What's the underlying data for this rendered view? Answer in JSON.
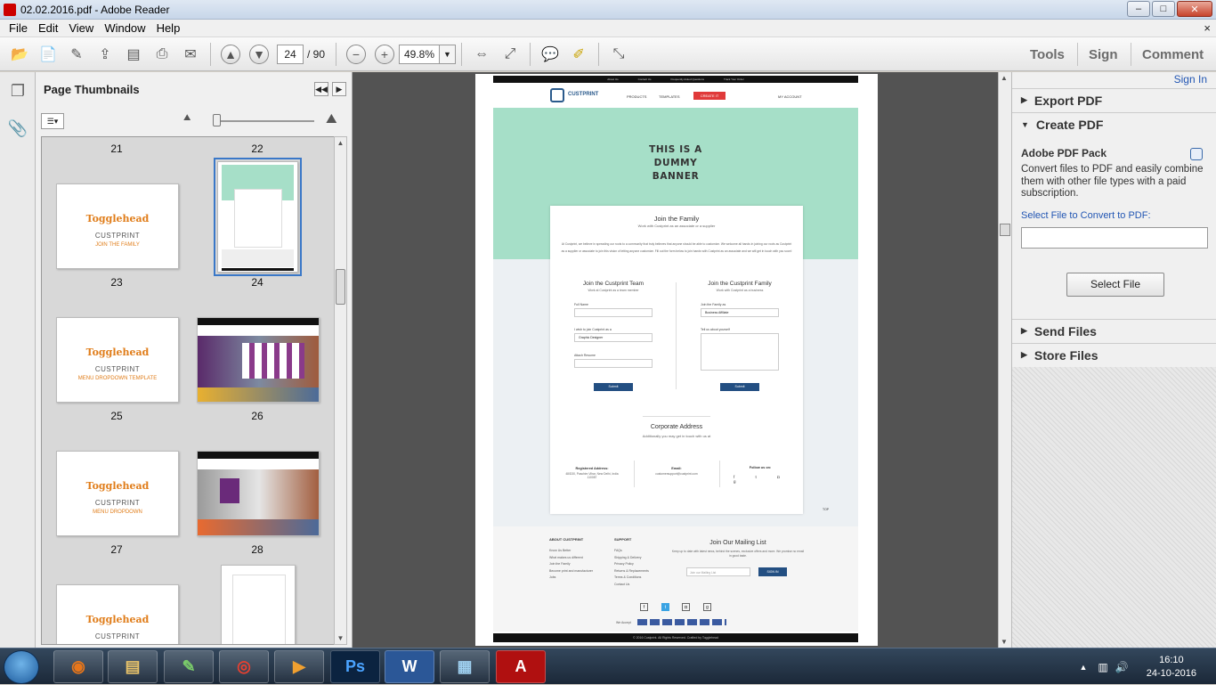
{
  "window": {
    "title": "02.02.2016.pdf - Adobe Reader",
    "minimize": "–",
    "maximize": "□",
    "close": "✕"
  },
  "menu": {
    "items": [
      "File",
      "Edit",
      "View",
      "Window",
      "Help"
    ],
    "close_glyph": "×"
  },
  "toolbar": {
    "page_current": "24",
    "page_total": "/ 90",
    "zoom": "49.8%",
    "right_tools": [
      "Tools",
      "Sign",
      "Comment"
    ]
  },
  "thumbnails": {
    "title": "Page Thumbnails",
    "page_labels": [
      "21",
      "22",
      "23",
      "24",
      "25",
      "26",
      "27",
      "28"
    ],
    "brand": "Togglehead",
    "thumb_title": "CUSTPRINT",
    "thumb_subtitles": [
      "JOIN THE FAMILY",
      "MENU DROPDOWN TEMPLATE",
      "MENU DROPDOWN"
    ],
    "selected_page": "24"
  },
  "doc": {
    "topbar_links": [
      "About Us",
      "Contact Us",
      "Frequently Asked Questions",
      "Track Your Order"
    ],
    "logo": "CUSTPRINT",
    "nav": [
      "PRODUCTS",
      "TEMPLATES",
      "CREATE IT",
      "MY ACCOUNT"
    ],
    "banner": "THIS IS A DUMMY BANNER",
    "join_title": "Join the Family",
    "join_sub": "Work with Custprint as an associate or a supplier",
    "join_body": "At Custprint, we believe in spreading our roots to a community that truly believes that anyone should be able to customize. We welcome all hands in joining our roots as Custprint as a supplier or associate to join this vision of letting anyone customize. Fill out the form below to join hands with Custprint as an associate and we will get in touch with you soon!",
    "team_title": "Join the Custprint Team",
    "team_sub": "Work at Custprint as a team member",
    "family_title": "Join the Custprint Family",
    "family_sub": "Work with Custprint as a business",
    "full_name": "Full Name",
    "wish_label": "I wish to join Custprint as a",
    "wish_value": "Graphic Designer",
    "attach": "Attach Resume",
    "join_as_label": "Join the Family as",
    "join_as_value": "Business Affiliate",
    "tell_label": "Tell us about yourself",
    "submit": "Submit",
    "corp_title": "Corporate Address",
    "corp_sub": "Additionally you may get in touch with us at",
    "reg_label": "Registered Address:",
    "reg_value": "48/D30, Paschim Vihar, New Delhi, India 110087",
    "email_label": "Email:",
    "email_value": "customersupport@custprint.com",
    "follow": "Follow us on:",
    "top": "TOP",
    "footer_about_h": "ABOUT CUSTPRINT",
    "footer_about": [
      "Know Us Better",
      "What makes us different",
      "Join the Family",
      "Become print and manufacturer",
      "Jobs"
    ],
    "footer_support_h": "SUPPORT",
    "footer_support": [
      "FAQs",
      "Shipping & Delivery",
      "Privacy Policy",
      "Returns & Replacements",
      "Terms & Conditions",
      "Contact Us"
    ],
    "mailing_title": "Join Our Mailing List",
    "mailing_sub": "Keep up to date with latest news, behind the scenes, exclusive offers and more. We promise no email in good taste.",
    "mailing_placeholder": "Join our Mailing List",
    "mailing_btn": "SIGN IN",
    "accept": "We Accept",
    "copyright": "© 2016 Custprint. All Rights Reserved. Crafted by Togglehead"
  },
  "rightpanel": {
    "signin": "Sign In",
    "export": "Export PDF",
    "create": "Create PDF",
    "pack_title": "Adobe PDF Pack",
    "pack_desc": "Convert files to PDF and easily combine them with other file types with a paid subscription.",
    "select_label": "Select File to Convert to PDF:",
    "select_btn": "Select File",
    "send": "Send Files",
    "store": "Store Files"
  },
  "taskbar": {
    "time": "16:10",
    "date": "24-10-2016",
    "apps": [
      "firefox-icon",
      "explorer-icon",
      "notepad-icon",
      "chrome-icon",
      "media-icon",
      "photoshop-icon",
      "word-icon",
      "image-icon",
      "acrobat-icon"
    ]
  }
}
